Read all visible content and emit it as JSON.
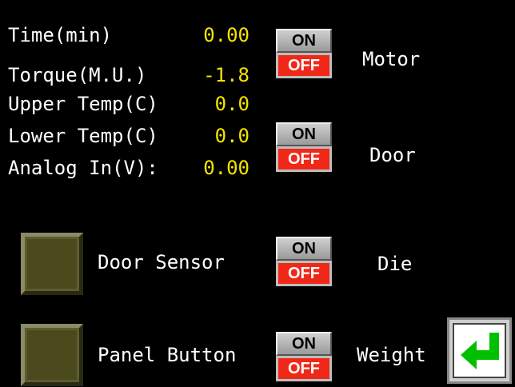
{
  "readouts": [
    {
      "label": "Time(min)",
      "value": "0.00"
    },
    {
      "label": "Torque(M.U.)",
      "value": "-1.8"
    },
    {
      "label": "Upper Temp(C)",
      "value": "0.0"
    },
    {
      "label": "Lower Temp(C)",
      "value": "0.0"
    },
    {
      "label": "Analog In(V):",
      "value": "0.00"
    }
  ],
  "switches": [
    {
      "name": "Motor",
      "on_label": "ON",
      "off_label": "OFF"
    },
    {
      "name": "Door",
      "on_label": "ON",
      "off_label": "OFF"
    },
    {
      "name": "Die",
      "on_label": "ON",
      "off_label": "OFF"
    },
    {
      "name": "Weight",
      "on_label": "ON",
      "off_label": "OFF"
    }
  ],
  "indicators": [
    {
      "label": "Door Sensor"
    },
    {
      "label": "Panel Button"
    }
  ],
  "enter_button": {
    "icon": "enter-arrow-icon",
    "color": "#00c000"
  },
  "colors": {
    "value": "#f5e400",
    "off": "#f02818",
    "indicator": "#4a4a1c"
  }
}
